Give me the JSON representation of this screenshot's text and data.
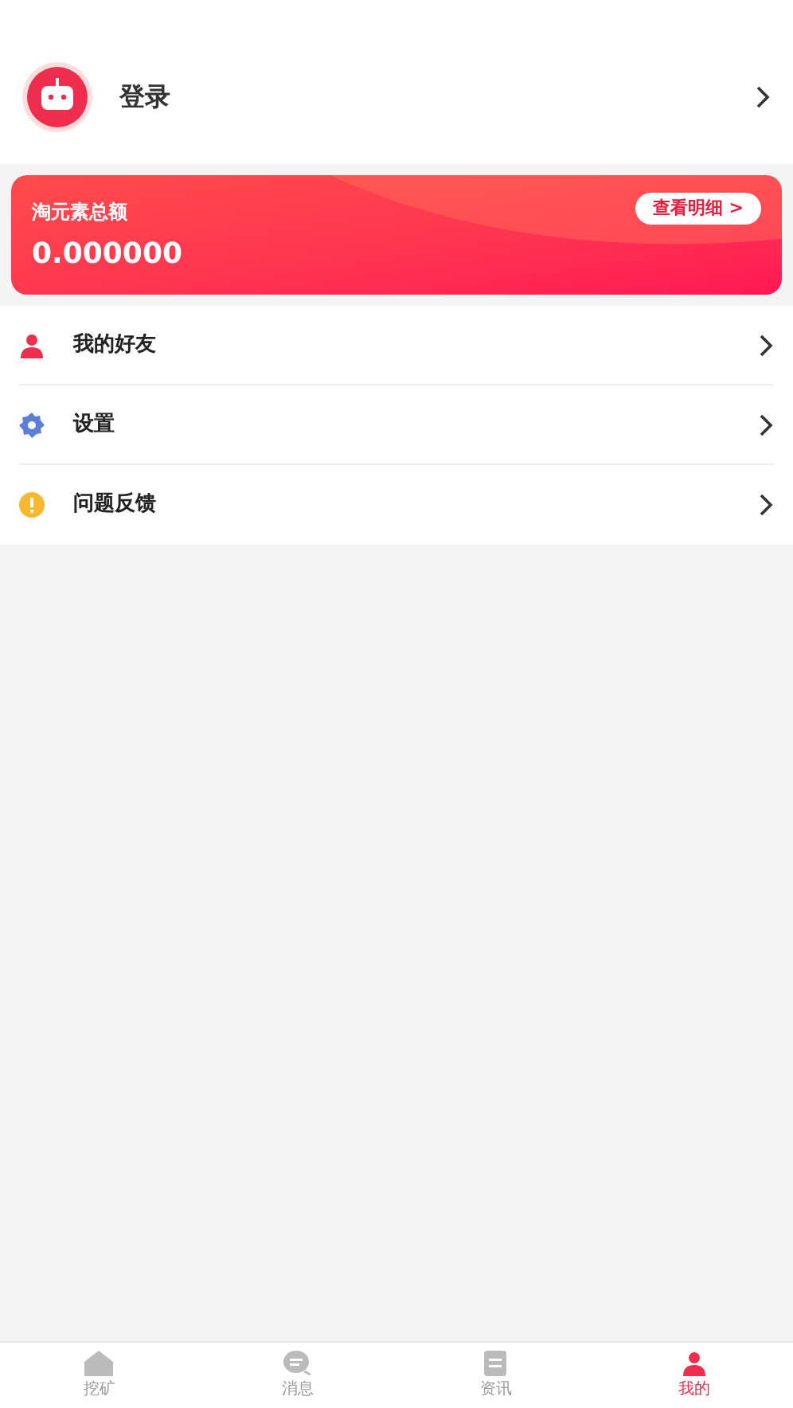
{
  "profile": {
    "login_label": "登录"
  },
  "balance_card": {
    "title": "淘元素总额",
    "amount": "0.000000",
    "details_button": "查看明细 >"
  },
  "menu": [
    {
      "kind": "person",
      "label": "我的好友"
    },
    {
      "kind": "gear",
      "label": "设置"
    },
    {
      "kind": "alert",
      "label": "问题反馈"
    }
  ],
  "tab_bar": [
    {
      "kind": "home",
      "label": "挖矿",
      "selected": false
    },
    {
      "kind": "chat",
      "label": "消息",
      "selected": false
    },
    {
      "kind": "news",
      "label": "资讯",
      "selected": false
    },
    {
      "kind": "person",
      "label": "我的",
      "selected": true
    }
  ]
}
